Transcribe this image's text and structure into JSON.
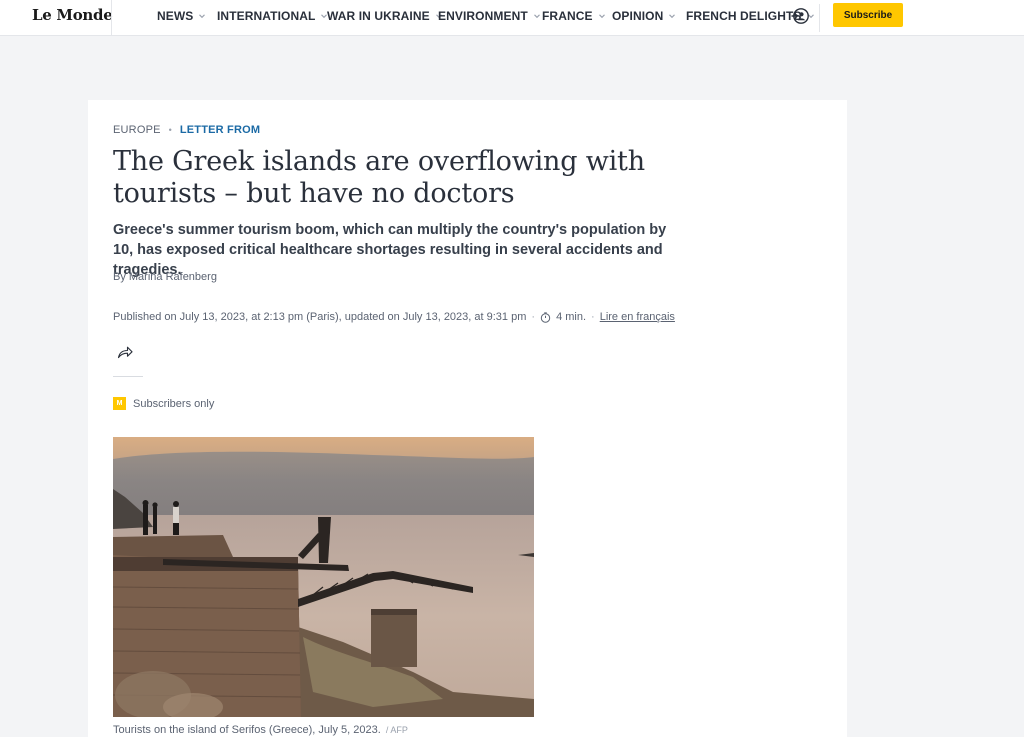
{
  "header": {
    "logo": "Le Monde",
    "nav": [
      {
        "label": "NEWS",
        "has_menu": true
      },
      {
        "label": "INTERNATIONAL",
        "has_menu": true
      },
      {
        "label": "WAR IN UKRAINE",
        "has_menu": true
      },
      {
        "label": "ENVIRONMENT",
        "has_menu": true
      },
      {
        "label": "FRANCE",
        "has_menu": true
      },
      {
        "label": "OPINION",
        "has_menu": true
      },
      {
        "label": "FRENCH DELIGHTS",
        "has_menu": true
      }
    ],
    "account_icon": "account-login-icon",
    "subscribe_label": "Subscribe"
  },
  "article": {
    "section": "EUROPE",
    "rubric": "LETTER FROM",
    "title": "The Greek islands are overflowing with tourists – but have no doctors",
    "description": "Greece's summer tourism boom, which can multiply the country's population by 10, has exposed critical healthcare shortages resulting in several accidents and tragedies.",
    "byline": "By Marina Rafenberg",
    "published": "Published on July 13, 2023, at 2:13 pm (Paris), updated on July 13, 2023, at 9:31 pm",
    "reading_time": "4 min.",
    "lang_link": "Lire en français",
    "share_icon": "share-arrow-icon",
    "subscribers_badge": "M",
    "subscribers_label": "Subscribers only",
    "photo_caption": "Tourists on the island of Serifos (Greece), July 5, 2023.",
    "photo_credit": "/ AFP"
  },
  "colors": {
    "accent_yellow": "#ffc700",
    "rubric_blue": "#1b6aa5",
    "text_dark": "#2a303b",
    "text_muted": "#5b6372",
    "page_bg": "#f3f4f6"
  }
}
